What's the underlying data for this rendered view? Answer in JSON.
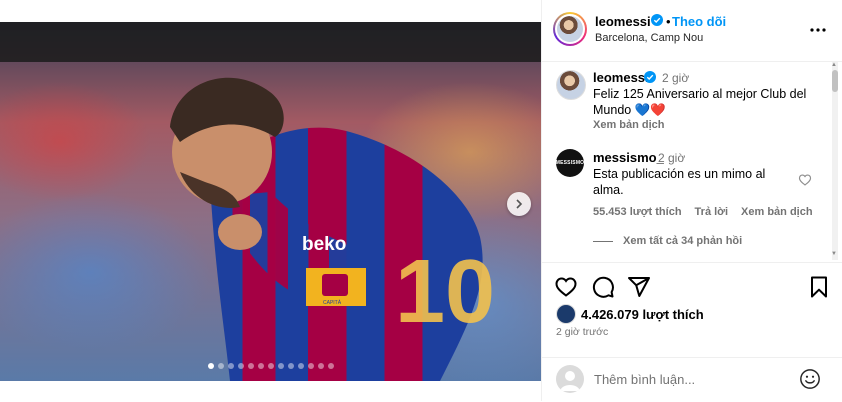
{
  "header": {
    "username": "leomessi",
    "separator": "•",
    "follow_label": "Theo dõi",
    "location": "Barcelona, Camp Nou"
  },
  "media": {
    "jersey_sponsor": "beko",
    "armband_text": "CAPITÀ",
    "jersey_number": "10",
    "carousel_dots": 13,
    "active_dot": 0
  },
  "comments": [
    {
      "username": "leomessi",
      "time": "2 giờ",
      "text": "Feliz 125 Aniversario al mejor Club del Mundo 💙❤️",
      "translate_label": "Xem bản dịch"
    },
    {
      "username": "messismo_",
      "avatar_text": "MESSISMO",
      "time": "2 giờ",
      "text": "Esta publicación es un mimo al alma.",
      "likes_label": "55.453 lượt thích",
      "reply_label": "Trả lời",
      "translate_label": "Xem bản dịch"
    }
  ],
  "view_replies_label": "Xem tất cả 34 phản hồi",
  "engagement": {
    "likes_label": "4.426.079 lượt thích",
    "posted_time": "2 giờ trước"
  },
  "comment_input": {
    "placeholder": "Thêm bình luận..."
  },
  "colors": {
    "accent": "#0095f6",
    "muted": "#737373",
    "border": "#efefef",
    "barca_blue": "#1d3f9e",
    "barca_red": "#a50044"
  }
}
